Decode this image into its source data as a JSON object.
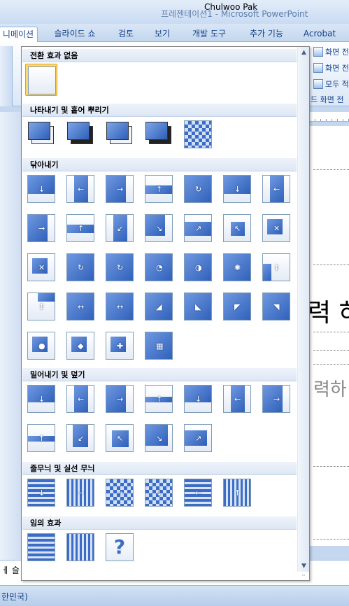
{
  "window": {
    "overlay_user": "Chulwoo Pak",
    "title": "프레젠테이션1 - Microsoft PowerPoint"
  },
  "tabs": [
    {
      "label": "니메이션",
      "active": true
    },
    {
      "label": "슬라이드 쇼",
      "active": false
    },
    {
      "label": "검토",
      "active": false
    },
    {
      "label": "보기",
      "active": false
    },
    {
      "label": "개발 도구",
      "active": false
    },
    {
      "label": "추가 기능",
      "active": false
    },
    {
      "label": "Acrobat",
      "active": false
    }
  ],
  "ribbon": {
    "items": [
      "화면 전",
      "화면 전",
      "모두 적"
    ],
    "group_label": "드 화면 전"
  },
  "gallery": {
    "sections": [
      {
        "title": "전환 효과 없음",
        "count": 1
      },
      {
        "title": "나타내기 및 흩어 뿌리기",
        "count": 5
      },
      {
        "title": "닦아내기",
        "count": 32
      },
      {
        "title": "밀어내기 및 덮기",
        "count": 12
      },
      {
        "title": "줄무늬 및 실선 무늬",
        "count": 6
      },
      {
        "title": "임의 효과",
        "count": 3
      }
    ],
    "selected_item": "전환 효과 없음",
    "random_glyph": "?"
  },
  "slide": {
    "title_fragment": "력 하",
    "subtitle_fragment": "력하"
  },
  "notes": {
    "text": "ㅔ 슬"
  },
  "status": {
    "text": "한민국)"
  },
  "colors": {
    "accent": "#15428b",
    "thumb_blue": "#3d6cc6",
    "selected": "#ffd86b"
  }
}
